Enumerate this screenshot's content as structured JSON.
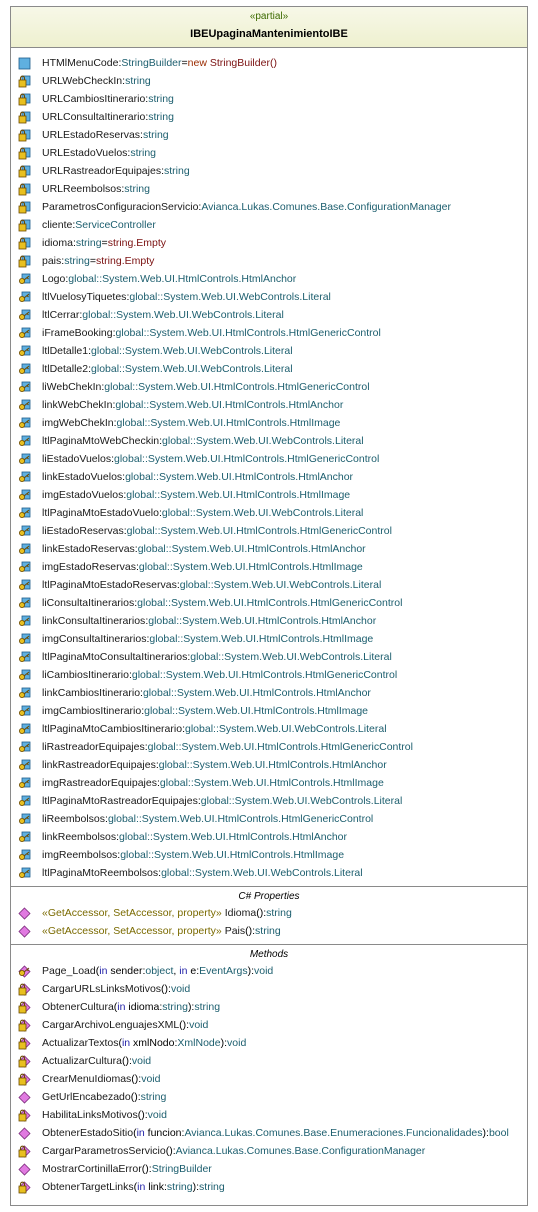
{
  "stereotype": "«partial»",
  "class_name": "IBEUpaginaMantenimientoIBE",
  "sections": {
    "fields_title": "",
    "properties_title": "C# Properties",
    "methods_title": "Methods"
  },
  "fields": [
    {
      "icon": "public-field-icon",
      "parts": [
        [
          "n",
          "HTMlMenuCode"
        ],
        [
          "p",
          ":"
        ],
        [
          "t",
          "StringBuilder"
        ],
        [
          "p",
          "="
        ],
        [
          "k",
          "new"
        ],
        [
          "p",
          " "
        ],
        [
          "v",
          "StringBuilder()"
        ]
      ]
    },
    {
      "icon": "private-field-icon",
      "parts": [
        [
          "n",
          "URLWebCheckIn"
        ],
        [
          "p",
          ":"
        ],
        [
          "t",
          "string"
        ]
      ]
    },
    {
      "icon": "private-field-icon",
      "parts": [
        [
          "n",
          "URLCambiosItinerario"
        ],
        [
          "p",
          ":"
        ],
        [
          "t",
          "string"
        ]
      ]
    },
    {
      "icon": "private-field-icon",
      "parts": [
        [
          "n",
          "URLConsultaItinerario"
        ],
        [
          "p",
          ":"
        ],
        [
          "t",
          "string"
        ]
      ]
    },
    {
      "icon": "private-field-icon",
      "parts": [
        [
          "n",
          "URLEstadoReservas"
        ],
        [
          "p",
          ":"
        ],
        [
          "t",
          "string"
        ]
      ]
    },
    {
      "icon": "private-field-icon",
      "parts": [
        [
          "n",
          "URLEstadoVuelos"
        ],
        [
          "p",
          ":"
        ],
        [
          "t",
          "string"
        ]
      ]
    },
    {
      "icon": "private-field-icon",
      "parts": [
        [
          "n",
          "URLRastreadorEquipajes"
        ],
        [
          "p",
          ":"
        ],
        [
          "t",
          "string"
        ]
      ]
    },
    {
      "icon": "private-field-icon",
      "parts": [
        [
          "n",
          "URLReembolsos"
        ],
        [
          "p",
          ":"
        ],
        [
          "t",
          "string"
        ]
      ]
    },
    {
      "icon": "private-field-icon",
      "parts": [
        [
          "n",
          "ParametrosConfiguracionServicio"
        ],
        [
          "p",
          ":"
        ],
        [
          "t",
          "Avianca.Lukas.Comunes.Base.ConfigurationManager"
        ]
      ]
    },
    {
      "icon": "private-field-icon",
      "parts": [
        [
          "n",
          "cliente"
        ],
        [
          "p",
          ":"
        ],
        [
          "t",
          "ServiceController"
        ]
      ]
    },
    {
      "icon": "private-field-icon",
      "parts": [
        [
          "n",
          "idioma"
        ],
        [
          "p",
          ":"
        ],
        [
          "t",
          "string"
        ],
        [
          "p",
          "="
        ],
        [
          "v",
          "string.Empty"
        ]
      ]
    },
    {
      "icon": "private-field-icon",
      "parts": [
        [
          "n",
          "pais"
        ],
        [
          "p",
          ":"
        ],
        [
          "t",
          "string"
        ],
        [
          "p",
          "="
        ],
        [
          "v",
          "string.Empty"
        ]
      ]
    },
    {
      "icon": "protected-field-icon",
      "parts": [
        [
          "n",
          "Logo"
        ],
        [
          "p",
          ":"
        ],
        [
          "t",
          "global::System.Web.UI.HtmlControls.HtmlAnchor"
        ]
      ]
    },
    {
      "icon": "protected-field-icon",
      "parts": [
        [
          "n",
          "ltlVuelosyTiquetes"
        ],
        [
          "p",
          ":"
        ],
        [
          "t",
          "global::System.Web.UI.WebControls.Literal"
        ]
      ]
    },
    {
      "icon": "protected-field-icon",
      "parts": [
        [
          "n",
          "ltlCerrar"
        ],
        [
          "p",
          ":"
        ],
        [
          "t",
          "global::System.Web.UI.WebControls.Literal"
        ]
      ]
    },
    {
      "icon": "protected-field-icon",
      "parts": [
        [
          "n",
          "iFrameBooking"
        ],
        [
          "p",
          ":"
        ],
        [
          "t",
          "global::System.Web.UI.HtmlControls.HtmlGenericControl"
        ]
      ]
    },
    {
      "icon": "protected-field-icon",
      "parts": [
        [
          "n",
          "ltlDetalle1"
        ],
        [
          "p",
          ":"
        ],
        [
          "t",
          "global::System.Web.UI.WebControls.Literal"
        ]
      ]
    },
    {
      "icon": "protected-field-icon",
      "parts": [
        [
          "n",
          "ltlDetalle2"
        ],
        [
          "p",
          ":"
        ],
        [
          "t",
          "global::System.Web.UI.WebControls.Literal"
        ]
      ]
    },
    {
      "icon": "protected-field-icon",
      "parts": [
        [
          "n",
          "liWebChekIn"
        ],
        [
          "p",
          ":"
        ],
        [
          "t",
          "global::System.Web.UI.HtmlControls.HtmlGenericControl"
        ]
      ]
    },
    {
      "icon": "protected-field-icon",
      "parts": [
        [
          "n",
          "linkWebChekIn"
        ],
        [
          "p",
          ":"
        ],
        [
          "t",
          "global::System.Web.UI.HtmlControls.HtmlAnchor"
        ]
      ]
    },
    {
      "icon": "protected-field-icon",
      "parts": [
        [
          "n",
          "imgWebChekIn"
        ],
        [
          "p",
          ":"
        ],
        [
          "t",
          "global::System.Web.UI.HtmlControls.HtmlImage"
        ]
      ]
    },
    {
      "icon": "protected-field-icon",
      "parts": [
        [
          "n",
          "ltlPaginaMtoWebCheckin"
        ],
        [
          "p",
          ":"
        ],
        [
          "t",
          "global::System.Web.UI.WebControls.Literal"
        ]
      ]
    },
    {
      "icon": "protected-field-icon",
      "parts": [
        [
          "n",
          "liEstadoVuelos"
        ],
        [
          "p",
          ":"
        ],
        [
          "t",
          "global::System.Web.UI.HtmlControls.HtmlGenericControl"
        ]
      ]
    },
    {
      "icon": "protected-field-icon",
      "parts": [
        [
          "n",
          "linkEstadoVuelos"
        ],
        [
          "p",
          ":"
        ],
        [
          "t",
          "global::System.Web.UI.HtmlControls.HtmlAnchor"
        ]
      ]
    },
    {
      "icon": "protected-field-icon",
      "parts": [
        [
          "n",
          "imgEstadoVuelos"
        ],
        [
          "p",
          ":"
        ],
        [
          "t",
          "global::System.Web.UI.HtmlControls.HtmlImage"
        ]
      ]
    },
    {
      "icon": "protected-field-icon",
      "parts": [
        [
          "n",
          "ltlPaginaMtoEstadoVuelo"
        ],
        [
          "p",
          ":"
        ],
        [
          "t",
          "global::System.Web.UI.WebControls.Literal"
        ]
      ]
    },
    {
      "icon": "protected-field-icon",
      "parts": [
        [
          "n",
          "liEstadoReservas"
        ],
        [
          "p",
          ":"
        ],
        [
          "t",
          "global::System.Web.UI.HtmlControls.HtmlGenericControl"
        ]
      ]
    },
    {
      "icon": "protected-field-icon",
      "parts": [
        [
          "n",
          "linkEstadoReservas"
        ],
        [
          "p",
          ":"
        ],
        [
          "t",
          "global::System.Web.UI.HtmlControls.HtmlAnchor"
        ]
      ]
    },
    {
      "icon": "protected-field-icon",
      "parts": [
        [
          "n",
          "imgEstadoReservas"
        ],
        [
          "p",
          ":"
        ],
        [
          "t",
          "global::System.Web.UI.HtmlControls.HtmlImage"
        ]
      ]
    },
    {
      "icon": "protected-field-icon",
      "parts": [
        [
          "n",
          "ltlPaginaMtoEstadoReservas"
        ],
        [
          "p",
          ":"
        ],
        [
          "t",
          "global::System.Web.UI.WebControls.Literal"
        ]
      ]
    },
    {
      "icon": "protected-field-icon",
      "parts": [
        [
          "n",
          "liConsultaItinerarios"
        ],
        [
          "p",
          ":"
        ],
        [
          "t",
          "global::System.Web.UI.HtmlControls.HtmlGenericControl"
        ]
      ]
    },
    {
      "icon": "protected-field-icon",
      "parts": [
        [
          "n",
          "linkConsultaItinerarios"
        ],
        [
          "p",
          ":"
        ],
        [
          "t",
          "global::System.Web.UI.HtmlControls.HtmlAnchor"
        ]
      ]
    },
    {
      "icon": "protected-field-icon",
      "parts": [
        [
          "n",
          "imgConsultaItinerarios"
        ],
        [
          "p",
          ":"
        ],
        [
          "t",
          "global::System.Web.UI.HtmlControls.HtmlImage"
        ]
      ]
    },
    {
      "icon": "protected-field-icon",
      "parts": [
        [
          "n",
          "ltlPaginaMtoConsultaItinerarios"
        ],
        [
          "p",
          ":"
        ],
        [
          "t",
          "global::System.Web.UI.WebControls.Literal"
        ]
      ]
    },
    {
      "icon": "protected-field-icon",
      "parts": [
        [
          "n",
          "liCambiosItinerario"
        ],
        [
          "p",
          ":"
        ],
        [
          "t",
          "global::System.Web.UI.HtmlControls.HtmlGenericControl"
        ]
      ]
    },
    {
      "icon": "protected-field-icon",
      "parts": [
        [
          "n",
          "linkCambiosItinerario"
        ],
        [
          "p",
          ":"
        ],
        [
          "t",
          "global::System.Web.UI.HtmlControls.HtmlAnchor"
        ]
      ]
    },
    {
      "icon": "protected-field-icon",
      "parts": [
        [
          "n",
          "imgCambiosItinerario"
        ],
        [
          "p",
          ":"
        ],
        [
          "t",
          "global::System.Web.UI.HtmlControls.HtmlImage"
        ]
      ]
    },
    {
      "icon": "protected-field-icon",
      "parts": [
        [
          "n",
          "ltlPaginaMtoCambiosItinerario"
        ],
        [
          "p",
          ":"
        ],
        [
          "t",
          "global::System.Web.UI.WebControls.Literal"
        ]
      ]
    },
    {
      "icon": "protected-field-icon",
      "parts": [
        [
          "n",
          "liRastreadorEquipajes"
        ],
        [
          "p",
          ":"
        ],
        [
          "t",
          "global::System.Web.UI.HtmlControls.HtmlGenericControl"
        ]
      ]
    },
    {
      "icon": "protected-field-icon",
      "parts": [
        [
          "n",
          "linkRastreadorEquipajes"
        ],
        [
          "p",
          ":"
        ],
        [
          "t",
          "global::System.Web.UI.HtmlControls.HtmlAnchor"
        ]
      ]
    },
    {
      "icon": "protected-field-icon",
      "parts": [
        [
          "n",
          "imgRastreadorEquipajes"
        ],
        [
          "p",
          ":"
        ],
        [
          "t",
          "global::System.Web.UI.HtmlControls.HtmlImage"
        ]
      ]
    },
    {
      "icon": "protected-field-icon",
      "parts": [
        [
          "n",
          "ltlPaginaMtoRastreadorEquipajes"
        ],
        [
          "p",
          ":"
        ],
        [
          "t",
          "global::System.Web.UI.WebControls.Literal"
        ]
      ]
    },
    {
      "icon": "protected-field-icon",
      "parts": [
        [
          "n",
          "liReembolsos"
        ],
        [
          "p",
          ":"
        ],
        [
          "t",
          "global::System.Web.UI.HtmlControls.HtmlGenericControl"
        ]
      ]
    },
    {
      "icon": "protected-field-icon",
      "parts": [
        [
          "n",
          "linkReembolsos"
        ],
        [
          "p",
          ":"
        ],
        [
          "t",
          "global::System.Web.UI.HtmlControls.HtmlAnchor"
        ]
      ]
    },
    {
      "icon": "protected-field-icon",
      "parts": [
        [
          "n",
          "imgReembolsos"
        ],
        [
          "p",
          ":"
        ],
        [
          "t",
          "global::System.Web.UI.HtmlControls.HtmlImage"
        ]
      ]
    },
    {
      "icon": "protected-field-icon",
      "parts": [
        [
          "n",
          "ltlPaginaMtoReembolsos"
        ],
        [
          "p",
          ":"
        ],
        [
          "t",
          "global::System.Web.UI.WebControls.Literal"
        ]
      ]
    }
  ],
  "properties": [
    {
      "icon": "public-property-icon",
      "parts": [
        [
          "s",
          "«GetAccessor, SetAccessor, property»"
        ],
        [
          "p",
          " "
        ],
        [
          "n",
          "Idioma"
        ],
        [
          "p",
          "():"
        ],
        [
          "t",
          "string"
        ]
      ]
    },
    {
      "icon": "public-property-icon",
      "parts": [
        [
          "s",
          "«GetAccessor, SetAccessor, property»"
        ],
        [
          "p",
          " "
        ],
        [
          "n",
          "Pais"
        ],
        [
          "p",
          "():"
        ],
        [
          "t",
          "string"
        ]
      ]
    }
  ],
  "methods": [
    {
      "icon": "protected-method-icon",
      "parts": [
        [
          "n",
          "Page_Load"
        ],
        [
          "p",
          "("
        ],
        [
          "m",
          "in"
        ],
        [
          "p",
          " sender:"
        ],
        [
          "t",
          "object"
        ],
        [
          "p",
          ", "
        ],
        [
          "m",
          "in"
        ],
        [
          "p",
          " e:"
        ],
        [
          "t",
          "EventArgs"
        ],
        [
          "p",
          "):"
        ],
        [
          "t",
          "void"
        ]
      ]
    },
    {
      "icon": "private-method-icon",
      "parts": [
        [
          "n",
          "CargarURLsLinksMotivos"
        ],
        [
          "p",
          "():"
        ],
        [
          "t",
          "void"
        ]
      ]
    },
    {
      "icon": "private-method-icon",
      "parts": [
        [
          "n",
          "ObtenerCultura"
        ],
        [
          "p",
          "("
        ],
        [
          "m",
          "in"
        ],
        [
          "p",
          " idioma:"
        ],
        [
          "t",
          "string"
        ],
        [
          "p",
          "):"
        ],
        [
          "t",
          "string"
        ]
      ]
    },
    {
      "icon": "private-method-icon",
      "parts": [
        [
          "n",
          "CargarArchivoLenguajesXML"
        ],
        [
          "p",
          "():"
        ],
        [
          "t",
          "void"
        ]
      ]
    },
    {
      "icon": "private-method-icon",
      "parts": [
        [
          "n",
          "ActualizarTextos"
        ],
        [
          "p",
          "("
        ],
        [
          "m",
          "in"
        ],
        [
          "p",
          " xmlNodo:"
        ],
        [
          "t",
          "XmlNode"
        ],
        [
          "p",
          "):"
        ],
        [
          "t",
          "void"
        ]
      ]
    },
    {
      "icon": "private-method-icon",
      "parts": [
        [
          "n",
          "ActualizarCultura"
        ],
        [
          "p",
          "():"
        ],
        [
          "t",
          "void"
        ]
      ]
    },
    {
      "icon": "private-method-icon",
      "parts": [
        [
          "n",
          "CrearMenuIdiomas"
        ],
        [
          "p",
          "():"
        ],
        [
          "t",
          "void"
        ]
      ]
    },
    {
      "icon": "public-method-icon",
      "parts": [
        [
          "n",
          "GetUrlEncabezado"
        ],
        [
          "p",
          "():"
        ],
        [
          "t",
          "string"
        ]
      ]
    },
    {
      "icon": "private-method-icon",
      "parts": [
        [
          "n",
          "HabilitaLinksMotivos"
        ],
        [
          "p",
          "():"
        ],
        [
          "t",
          "void"
        ]
      ]
    },
    {
      "icon": "public-method-icon",
      "parts": [
        [
          "n",
          "ObtenerEstadoSitio"
        ],
        [
          "p",
          "("
        ],
        [
          "m",
          "in"
        ],
        [
          "p",
          " funcion:"
        ],
        [
          "t",
          "Avianca.Lukas.Comunes.Base.Enumeraciones.Funcionalidades"
        ],
        [
          "p",
          "):"
        ],
        [
          "t",
          "bool"
        ]
      ]
    },
    {
      "icon": "private-method-icon",
      "parts": [
        [
          "n",
          "CargarParametrosServicio"
        ],
        [
          "p",
          "():"
        ],
        [
          "t",
          "Avianca.Lukas.Comunes.Base.ConfigurationManager"
        ]
      ]
    },
    {
      "icon": "public-method-icon",
      "parts": [
        [
          "n",
          "MostrarCortinillaError"
        ],
        [
          "p",
          "():"
        ],
        [
          "t",
          "StringBuilder"
        ]
      ]
    },
    {
      "icon": "private-method-icon",
      "parts": [
        [
          "n",
          "ObtenerTargetLinks"
        ],
        [
          "p",
          "("
        ],
        [
          "m",
          "in"
        ],
        [
          "p",
          " link:"
        ],
        [
          "t",
          "string"
        ],
        [
          "p",
          "):"
        ],
        [
          "t",
          "string"
        ]
      ]
    }
  ],
  "colors": {
    "type": "#1c5e6e",
    "keyword": "#9a2b00",
    "modifier": "#2222a8",
    "stereotype": "#7a6a00",
    "header_bg": "#eef0cf",
    "border": "#8a8a8a"
  }
}
